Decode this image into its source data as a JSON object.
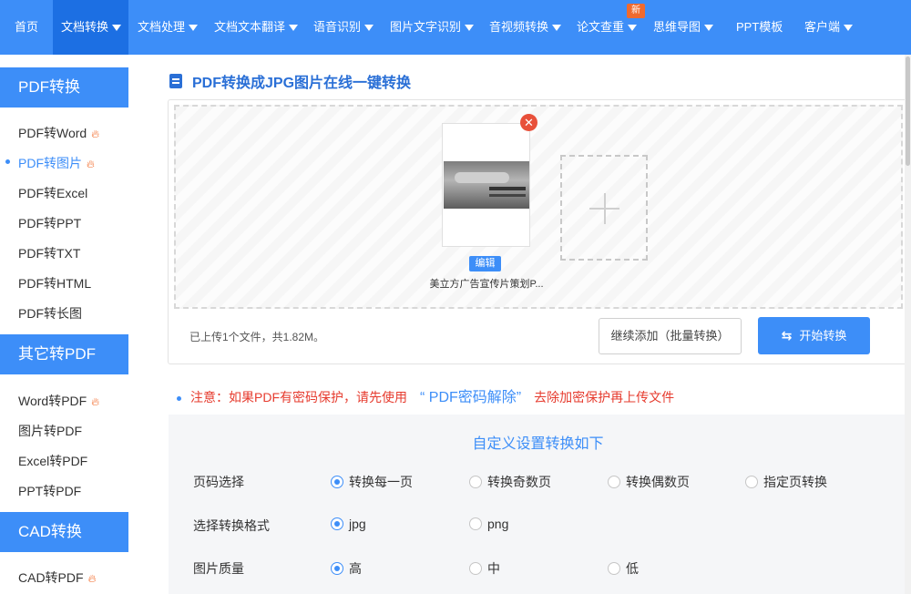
{
  "nav": {
    "items": [
      {
        "label": "首页",
        "caret": false
      },
      {
        "label": "文档转换",
        "caret": true,
        "active": true
      },
      {
        "label": "文档处理",
        "caret": true
      },
      {
        "label": "文档文本翻译",
        "caret": true
      },
      {
        "label": "语音识别",
        "caret": true
      },
      {
        "label": "图片文字识别",
        "caret": true
      },
      {
        "label": "音视频转换",
        "caret": true
      },
      {
        "label": "论文查重",
        "caret": true
      },
      {
        "label": "思维导图",
        "caret": true
      },
      {
        "label": "PPT模板",
        "caret": false
      },
      {
        "label": "客户端",
        "caret": true
      }
    ],
    "new_badge": "新"
  },
  "sidebar": {
    "section1": {
      "title": "PDF转换",
      "items": [
        "PDF转Word",
        "PDF转图片",
        "PDF转Excel",
        "PDF转PPT",
        "PDF转TXT",
        "PDF转HTML",
        "PDF转长图"
      ]
    },
    "section2": {
      "title": "其它转PDF",
      "items": [
        "Word转PDF",
        "图片转PDF",
        "Excel转PDF",
        "PPT转PDF"
      ]
    },
    "section3": {
      "title": "CAD转换",
      "items": [
        "CAD转PDF"
      ]
    },
    "hot_icon": "flame-icon"
  },
  "main": {
    "title": "PDF转换成JPG图片在线一键转换",
    "file": {
      "edit_label": "编辑",
      "name": "美立方广告宣传片策划P..."
    },
    "status": "已上传1个文件，共1.82M。",
    "continue_label": "继续添加（批量转换）",
    "start_label": "开始转换",
    "notice_prefix": "注意：如果PDF有密码保护，请先使用",
    "notice_link": "“ PDF密码解除”",
    "notice_suffix": "去除加密保护再上传文件"
  },
  "settings": {
    "title": "自定义设置转换如下",
    "rows": [
      {
        "label": "页码选择",
        "options": [
          "转换每一页",
          "转换奇数页",
          "转换偶数页",
          "指定页转换"
        ],
        "selected": 0
      },
      {
        "label": "选择转换格式",
        "options": [
          "jpg",
          "png"
        ],
        "selected": 0
      },
      {
        "label": "图片质量",
        "options": [
          "高",
          "中",
          "低"
        ],
        "selected": 0
      }
    ]
  },
  "colors": {
    "accent": "#3d8ef8",
    "nav_active": "#1c6fe3",
    "warning": "#e63b2e",
    "hot": "#f26522"
  }
}
